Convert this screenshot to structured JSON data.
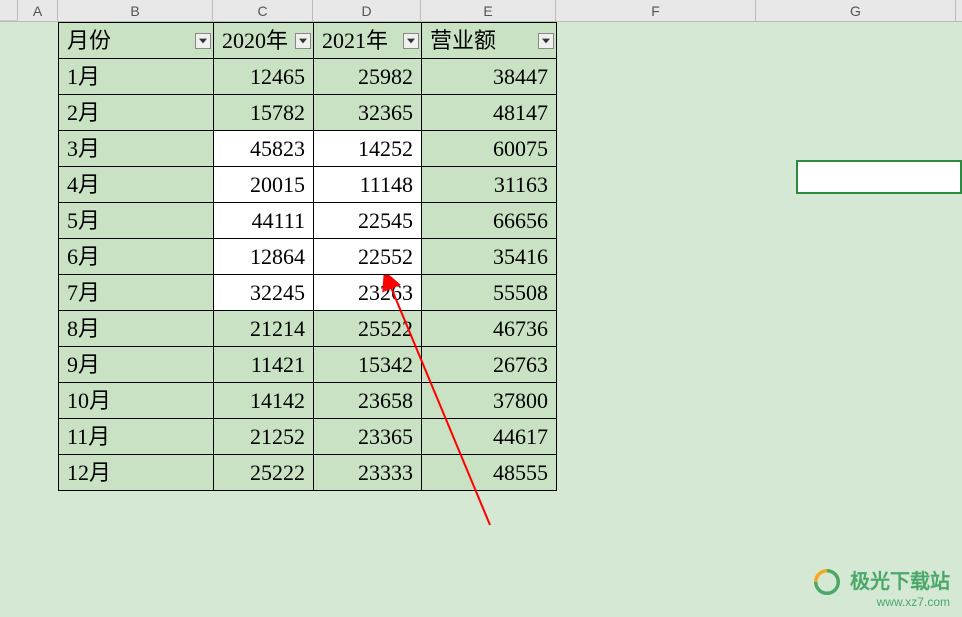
{
  "columns": [
    "A",
    "B",
    "C",
    "D",
    "E",
    "F",
    "G"
  ],
  "headers": {
    "month": "月份",
    "year2020": "2020年",
    "year2021": "2021年",
    "revenue": "营业额"
  },
  "rows": [
    {
      "month": "1月",
      "y2020": "12465",
      "y2021": "25982",
      "rev": "38447",
      "hl": true
    },
    {
      "month": "2月",
      "y2020": "15782",
      "y2021": "32365",
      "rev": "48147",
      "hl": true
    },
    {
      "month": "3月",
      "y2020": "45823",
      "y2021": "14252",
      "rev": "60075",
      "hl": false
    },
    {
      "month": "4月",
      "y2020": "20015",
      "y2021": "11148",
      "rev": "31163",
      "hl": false
    },
    {
      "month": "5月",
      "y2020": "44111",
      "y2021": "22545",
      "rev": "66656",
      "hl": false
    },
    {
      "month": "6月",
      "y2020": "12864",
      "y2021": "22552",
      "rev": "35416",
      "hl": false
    },
    {
      "month": "7月",
      "y2020": "32245",
      "y2021": "23263",
      "rev": "55508",
      "hl": false
    },
    {
      "month": "8月",
      "y2020": "21214",
      "y2021": "25522",
      "rev": "46736",
      "hl": true
    },
    {
      "month": "9月",
      "y2020": "11421",
      "y2021": "15342",
      "rev": "26763",
      "hl": true
    },
    {
      "month": "10月",
      "y2020": "14142",
      "y2021": "23658",
      "rev": "37800",
      "hl": true
    },
    {
      "month": "11月",
      "y2020": "21252",
      "y2021": "23365",
      "rev": "44617",
      "hl": true
    },
    {
      "month": "12月",
      "y2020": "25222",
      "y2021": "23333",
      "rev": "48555",
      "hl": true
    }
  ],
  "watermark": {
    "brand": "极光下载站",
    "url": "www.xz7.com"
  },
  "chart_data": {
    "type": "table",
    "title": "营业额",
    "columns": [
      "月份",
      "2020年",
      "2021年",
      "营业额"
    ],
    "data": [
      [
        "1月",
        12465,
        25982,
        38447
      ],
      [
        "2月",
        15782,
        32365,
        48147
      ],
      [
        "3月",
        45823,
        14252,
        60075
      ],
      [
        "4月",
        20015,
        11148,
        31163
      ],
      [
        "5月",
        44111,
        22545,
        66656
      ],
      [
        "6月",
        12864,
        22552,
        35416
      ],
      [
        "7月",
        32245,
        23263,
        55508
      ],
      [
        "8月",
        21214,
        25522,
        46736
      ],
      [
        "9月",
        11421,
        15342,
        26763
      ],
      [
        "10月",
        14142,
        23658,
        37800
      ],
      [
        "11月",
        21252,
        23365,
        44617
      ],
      [
        "12月",
        25222,
        23333,
        48555
      ]
    ]
  }
}
